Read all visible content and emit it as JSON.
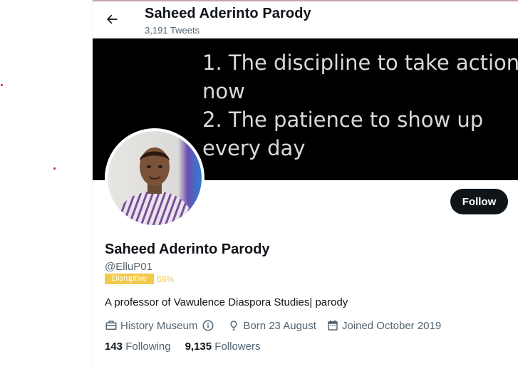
{
  "header": {
    "title": "Saheed Aderinto Parody",
    "tweet_count": "3,191 Tweets"
  },
  "banner": {
    "lines": [
      "1. The discipline to take action",
      "now",
      "2. The patience to show up",
      "every day"
    ]
  },
  "profile": {
    "name": "Saheed Aderinto Parody",
    "handle": "@ElluP01",
    "badge_label": "Disruptive",
    "badge_percent": "68%",
    "bio": "A professor of Vawulence Diaspora Studies| parody",
    "location": "History Museum",
    "birthday": "Born 23 August",
    "joined": "Joined October 2019",
    "following_count": "143",
    "following_label": "Following",
    "followers_count": "9,135",
    "followers_label": "Followers"
  },
  "actions": {
    "follow_label": "Follow"
  },
  "icons": {
    "back": "arrow-left-icon",
    "location": "briefcase-icon",
    "info": "info-icon",
    "birthday": "balloon-icon",
    "joined": "calendar-icon"
  },
  "colors": {
    "text": "#0f1419",
    "muted": "#536471",
    "follow_bg": "#0f1419",
    "badge": "#f2c94c",
    "banner_bg": "#000000"
  }
}
